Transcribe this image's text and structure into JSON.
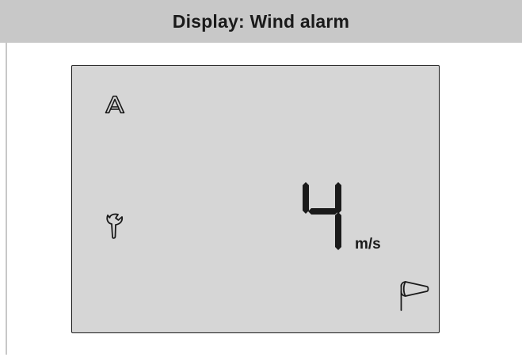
{
  "header": {
    "title": "Display: Wind alarm"
  },
  "lcd": {
    "auto_mode_indicator": {
      "icon": "auto-a-icon",
      "text": "A"
    },
    "service_indicator": {
      "icon": "wrench-icon"
    },
    "wind_value": "4",
    "wind_unit": "m/s",
    "wind_indicator": {
      "icon": "windsock-icon"
    }
  },
  "colors": {
    "header_bg": "#c8c8c8",
    "lcd_bg": "#d6d6d6",
    "segment": "#1a1a1a"
  }
}
